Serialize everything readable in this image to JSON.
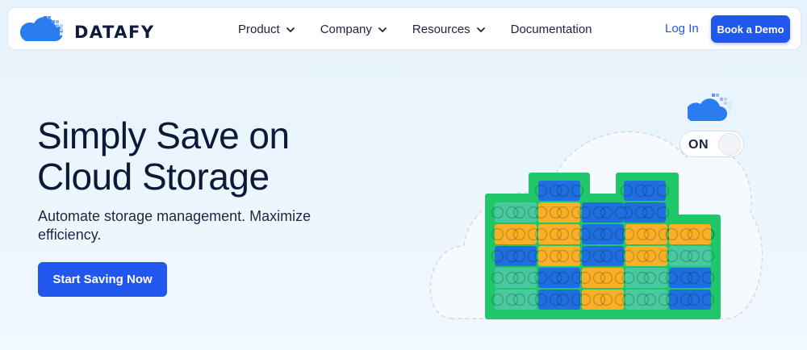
{
  "brand": {
    "name": "DATAFY",
    "logo_icon": "cloud-pixel-icon"
  },
  "nav": {
    "items": [
      {
        "label": "Product",
        "has_dropdown": true
      },
      {
        "label": "Company",
        "has_dropdown": true
      },
      {
        "label": "Resources",
        "has_dropdown": true
      },
      {
        "label": "Documentation",
        "has_dropdown": false
      }
    ],
    "login_label": "Log In",
    "demo_label": "Book a Demo"
  },
  "hero": {
    "title": "Simply Save on Cloud Storage",
    "subtitle": "Automate storage management. Maximize efficiency.",
    "cta_label": "Start Saving Now"
  },
  "illustration": {
    "toggle_label": "ON",
    "toggle_on": true,
    "colors": {
      "blue": "#1f6fe0",
      "orange": "#f9b026",
      "teal": "#48c9a0",
      "green_frame": "#20c76a"
    }
  },
  "colors": {
    "accent": "#2157ec",
    "text_dark": "#0e1838"
  }
}
